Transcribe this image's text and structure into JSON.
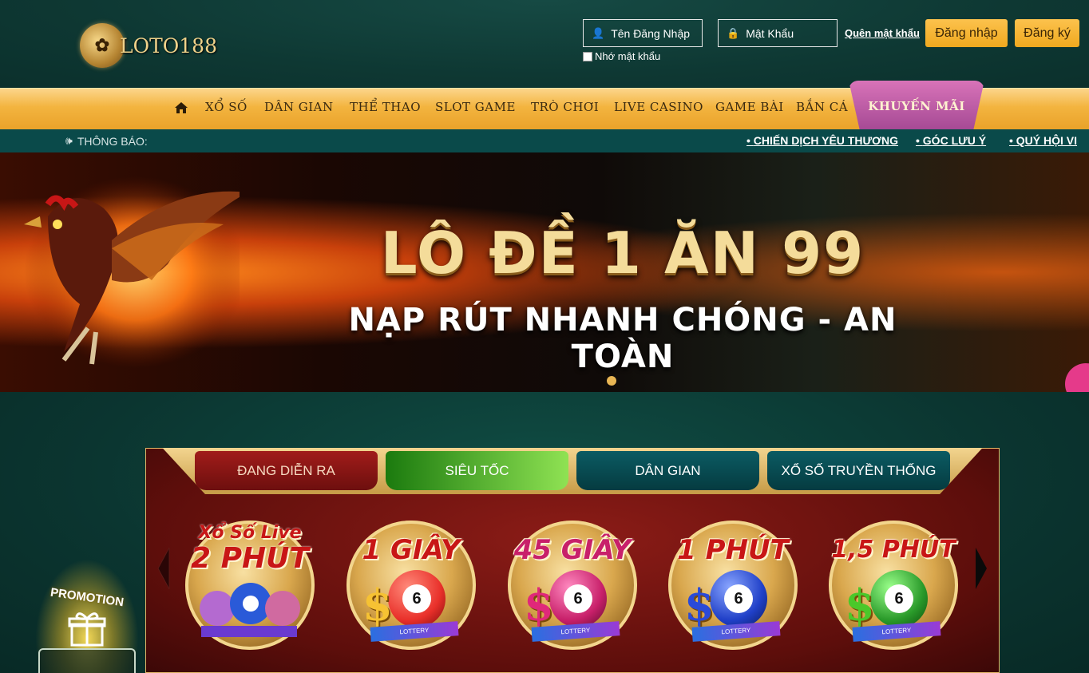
{
  "header": {
    "logo_text": "LOTO188",
    "username_placeholder": "Tên Đăng Nhập",
    "password_placeholder": "Mật Khẩu",
    "remember_label": "Nhớ mật khẩu",
    "forgot_label": "Quên mật khẩu",
    "login_button": "Đăng nhập",
    "register_button": "Đăng ký"
  },
  "nav": {
    "items": [
      "XỔ SỐ",
      "DÂN GIAN",
      "THỂ THAO",
      "SLOT GAME",
      "TRÒ CHƠI",
      "LIVE CASINO",
      "GAME BÀI",
      "BẮN CÁ"
    ],
    "promo": "KHUYẾN MÃI"
  },
  "notice": {
    "label": "THÔNG BÁO:",
    "links": [
      "CHIẾN DỊCH YÊU THƯƠNG",
      "GÓC LƯU Ý",
      "QUÝ HỘI VI"
    ]
  },
  "banner": {
    "title": "LÔ ĐỀ 1 ĂN 99",
    "subtitle": "NẠP RÚT NHANH CHÓNG - AN TOÀN",
    "slide_count": 1,
    "active_slide": 1
  },
  "tabs": [
    "ĐANG DIỄN RA",
    "SIÊU TỐC",
    "DÂN GIAN",
    "XỔ SỐ TRUYỀN THỐNG"
  ],
  "active_tab": "SIÊU TỐC",
  "games": {
    "live": {
      "top": "Xổ Số Live",
      "main": "2 PHÚT"
    },
    "items": [
      {
        "label": "1 GIÂY",
        "ball": "6",
        "ball_color": "#e9302a"
      },
      {
        "label": "45 GIÂY",
        "ball": "6",
        "ball_color": "#c8206a"
      },
      {
        "label": "1 PHÚT",
        "ball": "6",
        "ball_color": "#2040c8"
      },
      {
        "label": "1,5 PHÚT",
        "ball": "6",
        "ball_color": "#2a9a2a"
      }
    ]
  },
  "promotion": {
    "label": "PROMOTION"
  },
  "colors": {
    "gold": "#f0a91f",
    "teal": "#0d3a35",
    "promo_tab": "#a64a95",
    "panel_red": "#8c1c17"
  }
}
